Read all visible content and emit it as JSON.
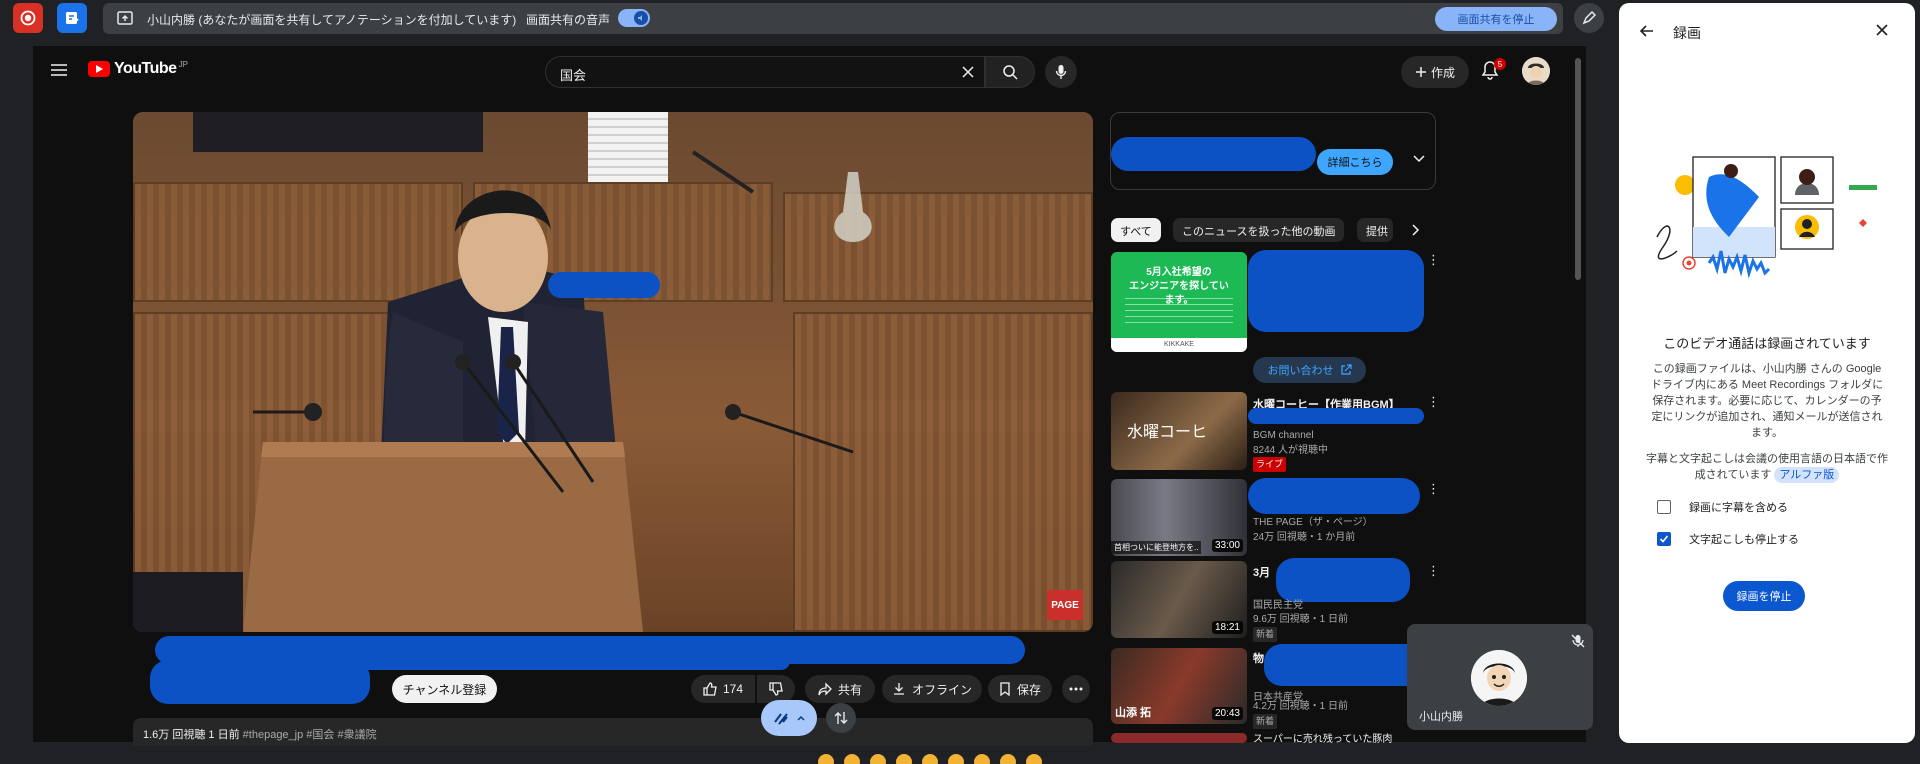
{
  "share_bar": {
    "share_message": "小山内勝 (あなたが画面を共有してアノテーションを付加しています)",
    "audio_label": "画面共有の音声",
    "stop_sharing_label": "画面共有を停止"
  },
  "youtube": {
    "logo_text": "YouTube",
    "logo_region": "JP",
    "search_value": "国会",
    "create_label": "作成",
    "notification_count": "5",
    "video": {
      "watermark": "PAGE",
      "subscribe_label": "チャンネル登録",
      "like_count": "174",
      "share_label": "共有",
      "offline_label": "オフライン",
      "save_label": "保存",
      "views": "1.6万 回視聴",
      "age": "1 日前",
      "hashtags": "#thepage_jp #国会 #衆議院"
    },
    "sidebar": {
      "ad_button_label": "詳細こちら",
      "chips": [
        "すべて",
        "このニュースを扱った他の動画",
        "提供"
      ],
      "ad_thumb_line1": "5月入社希望の",
      "ad_thumb_line2": "エンジニアを探しています。",
      "ad_thumb_brand": "KIKKAKE",
      "contact_label": "お問い合わせ",
      "videos": [
        {
          "thumb_text": "水曜コーヒ",
          "title": "水曜コーヒー【作業用BGM】",
          "channel": "BGM channel",
          "stats": "8244 人が視聴中",
          "badge": "ライブ"
        },
        {
          "thumb_text": "首相ついに能登地方を..",
          "duration": "33:00",
          "channel": "THE PAGE（ザ・ページ）",
          "stats": "24万 回視聴・1 か月前"
        },
        {
          "duration": "18:21",
          "title_prefix": "3月",
          "channel": "国民民主党",
          "stats": "9.6万 回視聴・1 日前",
          "badge": "新着"
        },
        {
          "thumb_text": "山添 拓",
          "duration": "20:43",
          "title_prefix": "物",
          "channel": "日本共産党",
          "stats": "4.2万 回視聴・1 日前",
          "badge": "新着"
        },
        {
          "title": "スーパーに売れ残っていた豚肉"
        }
      ]
    }
  },
  "self_tile": {
    "name": "小山内勝"
  },
  "recording_panel": {
    "title": "録画",
    "heading": "このビデオ通話は録画されています",
    "body": "この録画ファイルは、小山内勝 さんの Google ドライブ内にある Meet Recordings フォルダに保存されます。必要に応じて、カレンダーの予定にリンクが追加され、通知メールが送信されます。",
    "note": "字幕と文字起こしは会議の使用言語の日本語で作成されています",
    "alpha_label": "アルファ版",
    "option_captions": "録画に字幕を含める",
    "option_transcript": "文字起こしも停止する",
    "stop_label": "録画を停止"
  },
  "colors": {
    "meet_red": "#d93025",
    "meet_blue": "#1a73e8",
    "youtube_red": "#ff0000",
    "annotation_blue": "#0d52c4",
    "google_blue": "#0b57d0"
  }
}
